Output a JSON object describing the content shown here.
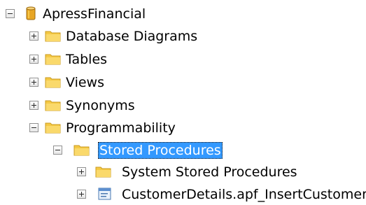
{
  "tree": {
    "root": {
      "label": "ApressFinancial",
      "expanded": true,
      "icon": "database-icon"
    },
    "folders": [
      {
        "label": "Database Diagrams",
        "expanded": false,
        "icon": "folder-icon"
      },
      {
        "label": "Tables",
        "expanded": false,
        "icon": "folder-icon"
      },
      {
        "label": "Views",
        "expanded": false,
        "icon": "folder-icon"
      },
      {
        "label": "Synonyms",
        "expanded": false,
        "icon": "folder-icon"
      },
      {
        "label": "Programmability",
        "expanded": true,
        "icon": "folder-icon"
      }
    ],
    "stored_procedures": {
      "label": "Stored Procedures",
      "expanded": true,
      "selected": true,
      "icon": "folder-icon",
      "children": [
        {
          "label": "System Stored Procedures",
          "expanded": false,
          "icon": "folder-icon"
        },
        {
          "label": "CustomerDetails.apf_InsertCustomer",
          "expanded": false,
          "icon": "stored-procedure-icon"
        }
      ]
    }
  },
  "colors": {
    "selection": "#3399ff",
    "folder": "#f5c945",
    "database": "#e0a526"
  }
}
